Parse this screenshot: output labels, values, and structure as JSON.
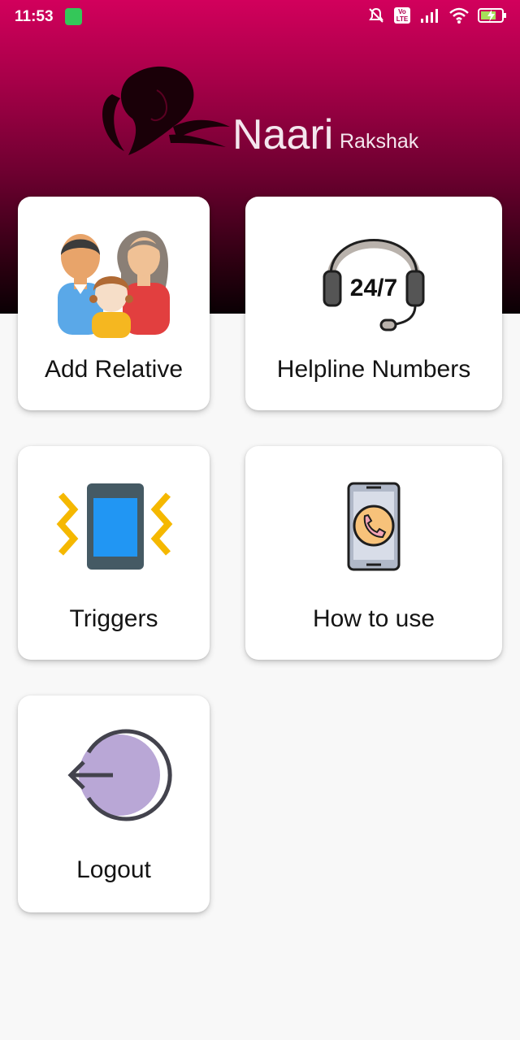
{
  "status_bar": {
    "time": "11:53",
    "network_badge_top": "Vo",
    "network_badge_bottom": "LTE"
  },
  "app": {
    "logo_main": "Naari",
    "logo_sub": "Rakshak"
  },
  "menu": {
    "items": [
      {
        "label": "Add Relative",
        "icon": "family-icon"
      },
      {
        "label": "Helpline Numbers",
        "icon": "headset-24-7-icon",
        "icon_text": "24/7"
      },
      {
        "label": "Triggers",
        "icon": "vibrating-phone-icon"
      },
      {
        "label": "How to use",
        "icon": "phone-call-icon"
      },
      {
        "label": "Logout",
        "icon": "logout-icon"
      }
    ]
  },
  "colors": {
    "header_top": "#d2005c",
    "header_bottom": "#0a0004",
    "background": "#f8f8f8"
  }
}
